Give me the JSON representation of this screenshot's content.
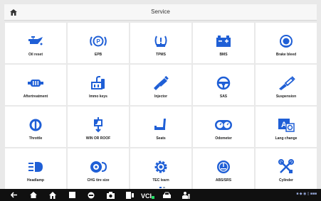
{
  "header": {
    "title": "Service",
    "home_icon": "home-icon"
  },
  "accent": "#1f5fd6",
  "tiles": [
    {
      "label": "Oil reset",
      "icon": "oil-can-icon"
    },
    {
      "label": "EPB",
      "icon": "parking-brake-icon"
    },
    {
      "label": "TPMS",
      "icon": "tire-pressure-icon"
    },
    {
      "label": "BMS",
      "icon": "battery-icon"
    },
    {
      "label": "Brake bleed",
      "icon": "brake-disc-icon"
    },
    {
      "label": "Aftertreatment",
      "icon": "exhaust-filter-icon"
    },
    {
      "label": "Immo keys",
      "icon": "key-immobilizer-icon"
    },
    {
      "label": "Injector",
      "icon": "injector-icon"
    },
    {
      "label": "SAS",
      "icon": "steering-wheel-icon"
    },
    {
      "label": "Suspension",
      "icon": "suspension-icon"
    },
    {
      "label": "Throttle",
      "icon": "throttle-icon"
    },
    {
      "label": "WIN OR ROOF",
      "icon": "window-roof-icon"
    },
    {
      "label": "Seats",
      "icon": "seat-icon"
    },
    {
      "label": "Odometer",
      "icon": "odometer-icon"
    },
    {
      "label": "Lang change",
      "icon": "language-icon"
    },
    {
      "label": "Headlamp",
      "icon": "headlamp-icon"
    },
    {
      "label": "CHG tire size",
      "icon": "tire-size-icon"
    },
    {
      "label": "TEC learn",
      "icon": "gear-learn-icon"
    },
    {
      "label": "ABS/SRS",
      "icon": "abs-srs-icon"
    },
    {
      "label": "Cylinder",
      "icon": "cylinder-tools-icon"
    }
  ],
  "taskbar": {
    "status_text": "■ ◆ ◉ ▯ ■■■",
    "icons": [
      "back-icon",
      "home-icon",
      "house-icon",
      "square-icon",
      "browser-icon",
      "camera-icon",
      "screenshot-icon",
      "vci-icon",
      "car-icon",
      "person-icon"
    ],
    "vci_label": "VCI"
  }
}
